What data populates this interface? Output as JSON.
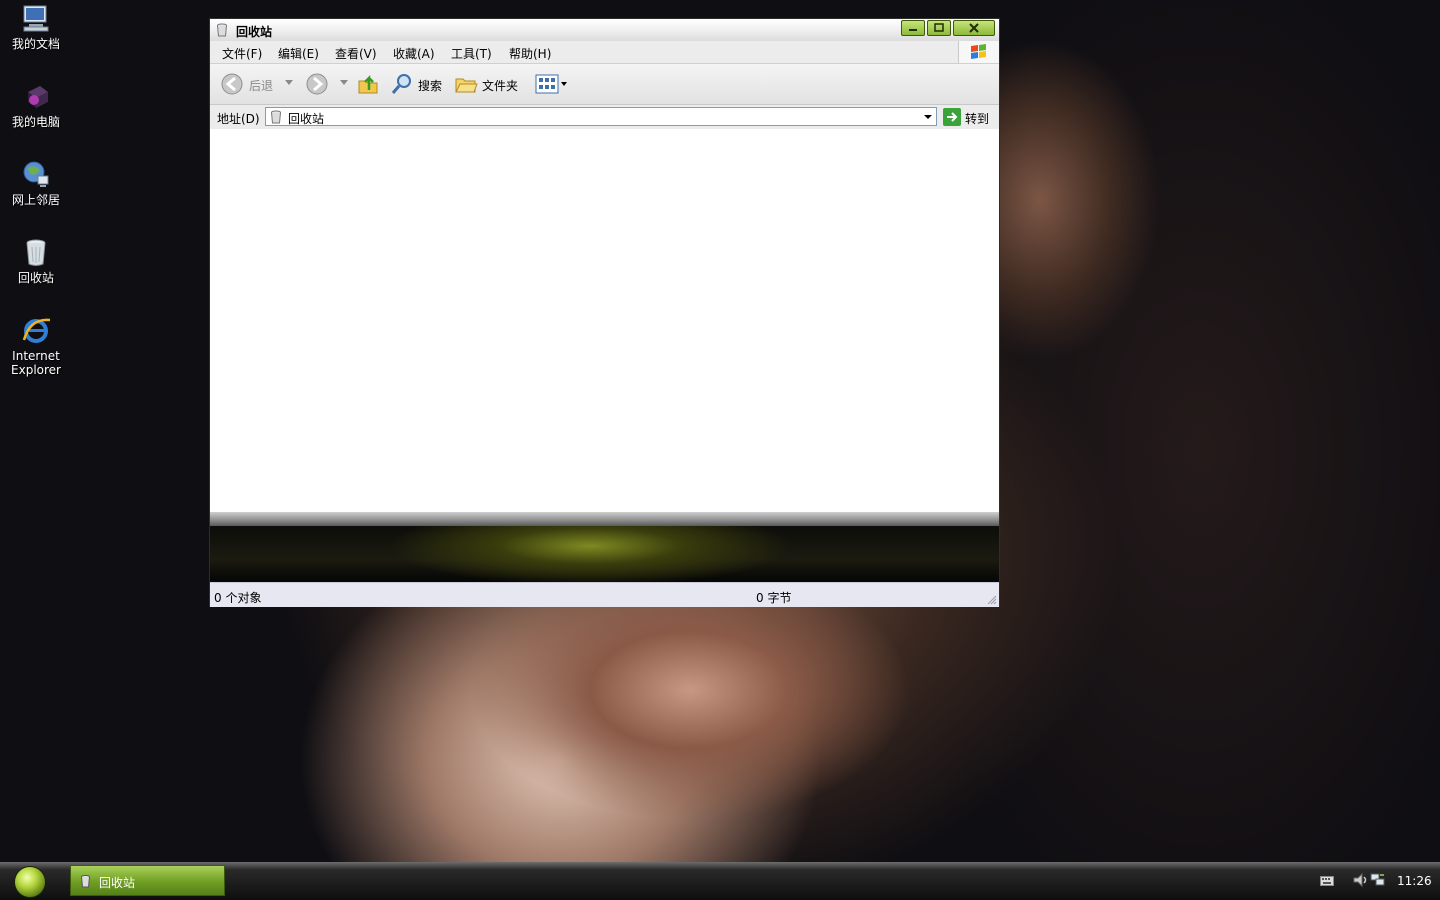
{
  "desktop": {
    "icons": [
      {
        "label": "我的文档",
        "icon": "my-documents-icon"
      },
      {
        "label": "我的电脑",
        "icon": "my-computer-icon"
      },
      {
        "label": "网上邻居",
        "icon": "network-places-icon"
      },
      {
        "label": "回收站",
        "icon": "recycle-bin-icon"
      },
      {
        "label": "Internet\nExplorer",
        "label_line1": "Internet",
        "label_line2": "Explorer",
        "icon": "ie-icon"
      }
    ]
  },
  "window": {
    "title": "回收站",
    "menu": [
      "文件(F)",
      "编辑(E)",
      "查看(V)",
      "收藏(A)",
      "工具(T)",
      "帮助(H)"
    ],
    "toolbar": {
      "back_label": "后退",
      "search_label": "搜索",
      "folders_label": "文件夹"
    },
    "address": {
      "label": "地址(D)",
      "value": "回收站",
      "go_label": "转到"
    },
    "status": {
      "objects": "0 个对象",
      "size": "0 字节"
    }
  },
  "taskbar": {
    "items": [
      {
        "label": "回收站"
      }
    ],
    "clock": "11:26"
  },
  "colors": {
    "accent_green": "#8cb93a",
    "taskbar_dark": "#0e0e0e",
    "status_bg": "#e7e7f2"
  }
}
